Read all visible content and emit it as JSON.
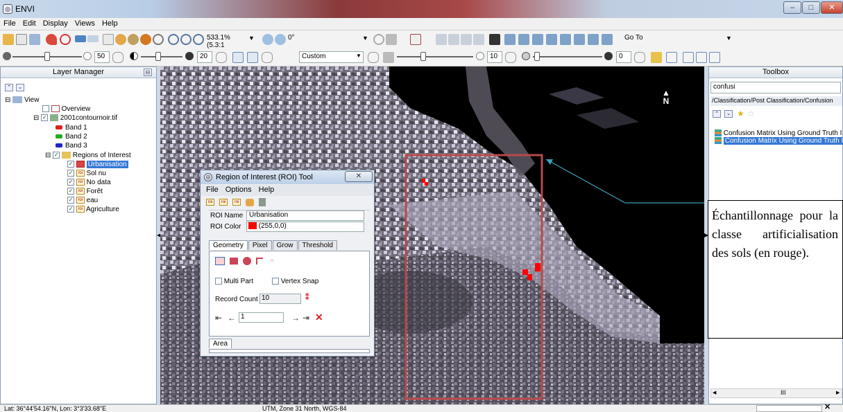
{
  "window": {
    "app_title": "ENVI"
  },
  "menu": [
    "File",
    "Edit",
    "Display",
    "Views",
    "Help"
  ],
  "toolbar": {
    "zoom_value": "533.1% (5.3:1",
    "rotation_value": "0°",
    "goto_placeholder": "Go To",
    "stretch_value": "Custom",
    "brightness_value": "50",
    "contrast_value": "20",
    "sharpen_value": "10",
    "transparency_value": "0"
  },
  "layer_manager": {
    "title": "Layer Manager",
    "tree": {
      "view": "View",
      "overview": "Overview",
      "raster": "2001contournoir.tif",
      "bands": [
        "Band 1",
        "Band 2",
        "Band 3"
      ],
      "regions": "Regions of Interest",
      "rois": [
        "Urbanisation",
        "Sol nu",
        "No data",
        "Forêt",
        "eau",
        "Agriculture"
      ]
    }
  },
  "toolbox": {
    "title": "Toolbox",
    "search_value": "confusi",
    "path": "/Classification/Post Classification/Confusion",
    "results": [
      "Confusion Matrix Using Ground Truth I",
      "Confusion Matrix Using Ground Truth I"
    ],
    "scroll_label": "III"
  },
  "roi_dialog": {
    "title": "Region of Interest (ROI) Tool",
    "menu": [
      "File",
      "Options",
      "Help"
    ],
    "name_label": "ROI Name",
    "name_value": "Urbanisation",
    "color_label": "ROI Color",
    "color_value": "(255,0,0)",
    "color_hex": "#ff0000",
    "tabs": [
      "Geometry",
      "Pixel",
      "Grow",
      "Threshold"
    ],
    "multipart_label": "Multi Part",
    "vertex_snap_label": "Vertex Snap",
    "record_count_label": "Record Count",
    "record_count_value": "10",
    "record_value": "1",
    "area_tab": "Area"
  },
  "view": {
    "north_label": "N"
  },
  "callout": {
    "text": "Échantillonnage pour la classe artificialisation des sols (en rouge)."
  },
  "status": {
    "coords": "Lat: 36°44'54.16\"N, Lon: 3°3'33.68\"E",
    "projection": "UTM, Zone 31 North, WGS-84"
  },
  "colors": {
    "highlight": "#b74a4a",
    "callout_line": "#3aa0b8",
    "roi_red": "#ff0000"
  }
}
